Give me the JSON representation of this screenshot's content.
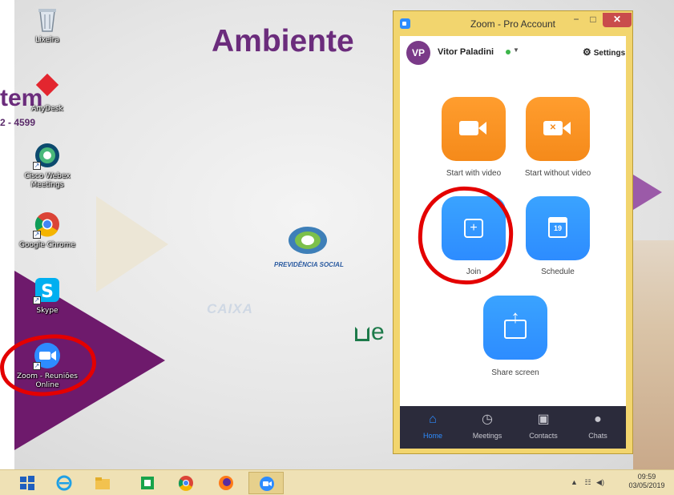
{
  "wallpaper": {
    "title": "Ambiente",
    "stem": "tem",
    "phone": "2 - 4599",
    "prev_text": "PREVIDÊNCIA SOCIAL",
    "caixa": "CAIXA",
    "e_text": "e"
  },
  "desktop_icons": [
    {
      "label": "Lixeira",
      "icon": "recycle-bin-icon"
    },
    {
      "label": "AnyDesk",
      "icon": "anydesk-icon"
    },
    {
      "label": "Cisco Webex Meetings",
      "icon": "webex-icon"
    },
    {
      "label": "Google Chrome",
      "icon": "chrome-icon"
    },
    {
      "label": "Skype",
      "icon": "skype-icon"
    },
    {
      "label": "Zoom - Reuniões Online",
      "icon": "zoom-icon"
    }
  ],
  "zoom_window": {
    "title": "Zoom - Pro Account",
    "user": {
      "initials": "VP",
      "name": "Vitor Paladini",
      "status_color": "#3cb54a"
    },
    "settings_label": "Settings",
    "tiles": [
      {
        "label": "Start with video",
        "color": "orange"
      },
      {
        "label": "Start without video",
        "color": "orange"
      },
      {
        "label": "Join",
        "color": "blue"
      },
      {
        "label": "Schedule",
        "color": "blue",
        "calendar_day": "19"
      },
      {
        "label": "Share screen",
        "color": "blue"
      }
    ],
    "nav": [
      {
        "label": "Home",
        "icon": "home-icon",
        "active": true
      },
      {
        "label": "Meetings",
        "icon": "clock-icon",
        "active": false
      },
      {
        "label": "Contacts",
        "icon": "contacts-icon",
        "active": false
      },
      {
        "label": "Chats",
        "icon": "chat-icon",
        "active": false
      }
    ]
  },
  "taskbar": {
    "time": "09:59",
    "date": "03/05/2019",
    "tray_icons": [
      "network-icon",
      "volume-icon"
    ]
  },
  "colors": {
    "zoom_blue": "#2d8cff",
    "zoom_orange": "#f58a1a",
    "annotation_red": "#e40000",
    "window_frame": "#f2d56e"
  }
}
